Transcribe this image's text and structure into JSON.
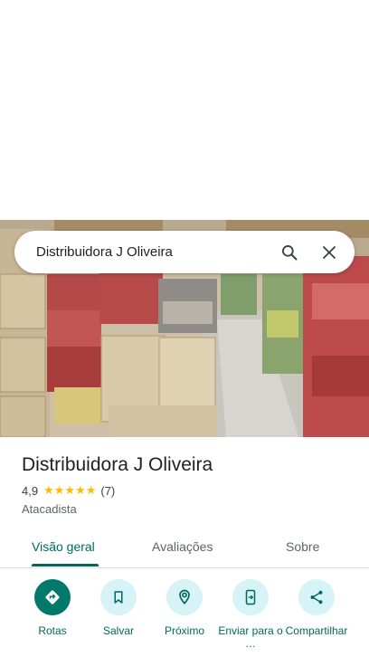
{
  "search": {
    "query": "Distribuidora J Oliveira",
    "search_icon": "search-icon",
    "close_icon": "close-icon"
  },
  "place": {
    "name": "Distribuidora J Oliveira",
    "rating": "4,9",
    "stars": "★★★★★",
    "review_count": "(7)",
    "category": "Atacadista"
  },
  "tabs": [
    {
      "label": "Visão geral",
      "active": true
    },
    {
      "label": "Avaliações",
      "active": false
    },
    {
      "label": "Sobre",
      "active": false
    }
  ],
  "actions": [
    {
      "label": "Rotas",
      "icon": "directions-icon"
    },
    {
      "label": "Salvar",
      "icon": "bookmark-icon"
    },
    {
      "label": "Próximo",
      "icon": "nearby-icon"
    },
    {
      "label": "Enviar para o …",
      "icon": "send-to-phone-icon"
    },
    {
      "label": "Compartilhar",
      "icon": "share-icon"
    }
  ],
  "colors": {
    "accent": "#00695c",
    "primary_button": "#00796b",
    "secondary_button": "#d6f3f7",
    "star": "#fbbc04"
  }
}
